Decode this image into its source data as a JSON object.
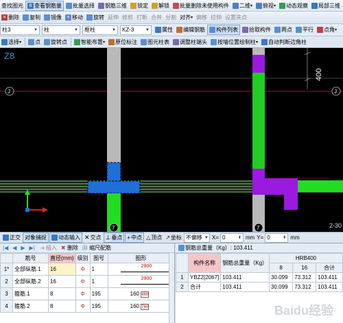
{
  "toolbar1": {
    "items": [
      "查找图元",
      "查看钢筋量",
      "批量选择",
      "钢筋三维",
      "锁定",
      "解锁",
      "批量删除未使用构件",
      "二维",
      "俯视",
      "动态观察",
      "局部三维"
    ]
  },
  "toolbar2": {
    "items": [
      "删除",
      "复制",
      "镜像",
      "移动",
      "旋转",
      "延伸",
      "修剪",
      "打断",
      "合并",
      "分割",
      "对齐",
      "偏移",
      "拉伸",
      "设置夹点"
    ]
  },
  "toolbar3": {
    "floor": "柱3",
    "type": "柱",
    "subtype": "框柱",
    "component": "KZ-3",
    "buttons": [
      "属性",
      "编辑钢筋",
      "构件列表",
      "拾取构件",
      "两点",
      "平行",
      "点角"
    ]
  },
  "toolbar4": {
    "items": [
      "选择",
      "点",
      "旋转点",
      "智能布置",
      "原位标注",
      "图元柱表",
      "调整柱端头",
      "按墙位置绘制柱",
      "自动判断边角柱"
    ]
  },
  "canvas": {
    "grid_top_label": "Z8",
    "dim_label": "400",
    "axis_left": "J",
    "axis_right": "J",
    "axis_bottom_right": "2-30",
    "bottom_marker_1": "7",
    "bottom_marker_2": "7"
  },
  "statusbar": {
    "items": [
      "正交",
      "对象捕捉",
      "动态输入",
      "交点",
      "垂点",
      "中点",
      "顶点",
      "坐标",
      "不偏移"
    ],
    "x_label": "X=",
    "x_value": "0",
    "x_unit": "mm",
    "y_label": "Y=",
    "y_value": "0",
    "y_unit": "mm"
  },
  "rebar_panel": {
    "toolbar": [
      "插入",
      "删除",
      "缩尺配筋"
    ],
    "columns": [
      "筋号",
      "直径(mm)",
      "级别",
      "图号",
      "图形"
    ],
    "rows": [
      {
        "num": "1*",
        "name": "全部纵筋.1",
        "dia": "16",
        "grade": "Φ",
        "fig": "1",
        "shape": "2900"
      },
      {
        "num": "2",
        "name": "全部纵筋.2",
        "dia": "16",
        "grade": "Φ",
        "fig": "1",
        "shape": "2900"
      },
      {
        "num": "3",
        "name": "箍筋.1",
        "dia": "8",
        "grade": "Φ",
        "fig": "195",
        "shape": "160",
        "shape2": "460"
      },
      {
        "num": "4",
        "name": "箍筋.2",
        "dia": "8",
        "grade": "Φ",
        "fig": "195",
        "shape": "160",
        "shape2": "760"
      }
    ]
  },
  "total_panel": {
    "title": "钢筋总重量（Kg）: 103.411",
    "group_header": "HRB400",
    "columns": [
      "构件名称",
      "钢筋总重量（Kg）",
      "8",
      "16",
      "合计"
    ],
    "rows": [
      {
        "num": "1",
        "name": "YBZ2[2067]",
        "total": "103.411",
        "c8": "30.099",
        "c16": "73.312",
        "sum": "103.411"
      },
      {
        "num": "2",
        "name": "合计",
        "total": "103.411",
        "c8": "30.099",
        "c16": "73.312",
        "sum": "103.411"
      }
    ]
  },
  "watermark": "Baidu经验"
}
